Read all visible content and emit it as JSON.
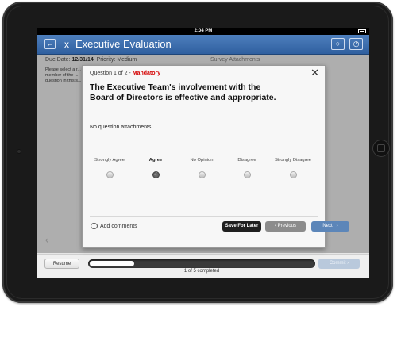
{
  "status_bar": {
    "time": "2:04 PM"
  },
  "header": {
    "title": "Executive Evaluation",
    "back_icon": "back-arrow-icon",
    "app_icon": "antenna-icon",
    "right_icons": [
      "user-icon",
      "clock-icon"
    ]
  },
  "background": {
    "due_label": "Due Date:",
    "due_value": "12/31/14",
    "priority_label": "Priority:",
    "priority_value": "Medium",
    "attachments_label": "Survey Attachments",
    "description": "Please select a r... a member of the ... question in this s..."
  },
  "modal": {
    "question_number": "Question 1 of 2 -",
    "mandatory_label": "Mandatory",
    "question_text": "The Executive Team's involvement with the Board of Directors is effective and appropriate.",
    "no_attachments": "No question attachments",
    "options": [
      {
        "label": "Strongly Agree",
        "selected": false
      },
      {
        "label": "Agree",
        "selected": true
      },
      {
        "label": "No Opinion",
        "selected": false
      },
      {
        "label": "Disagree",
        "selected": false
      },
      {
        "label": "Strongly Disagree",
        "selected": false
      }
    ],
    "add_comments": "Add comments",
    "save_later": "Save For Later",
    "previous": "Previous",
    "next": "Next"
  },
  "footer": {
    "resume": "Resume",
    "progress_text": "1 of 5 completed",
    "progress_fraction": 0.2,
    "commit": "Commit"
  },
  "colors": {
    "nav_blue": "#3a6aa8",
    "mandatory_red": "#d40000",
    "next_blue": "#5c86b9",
    "save_dark": "#1f1f1f"
  }
}
